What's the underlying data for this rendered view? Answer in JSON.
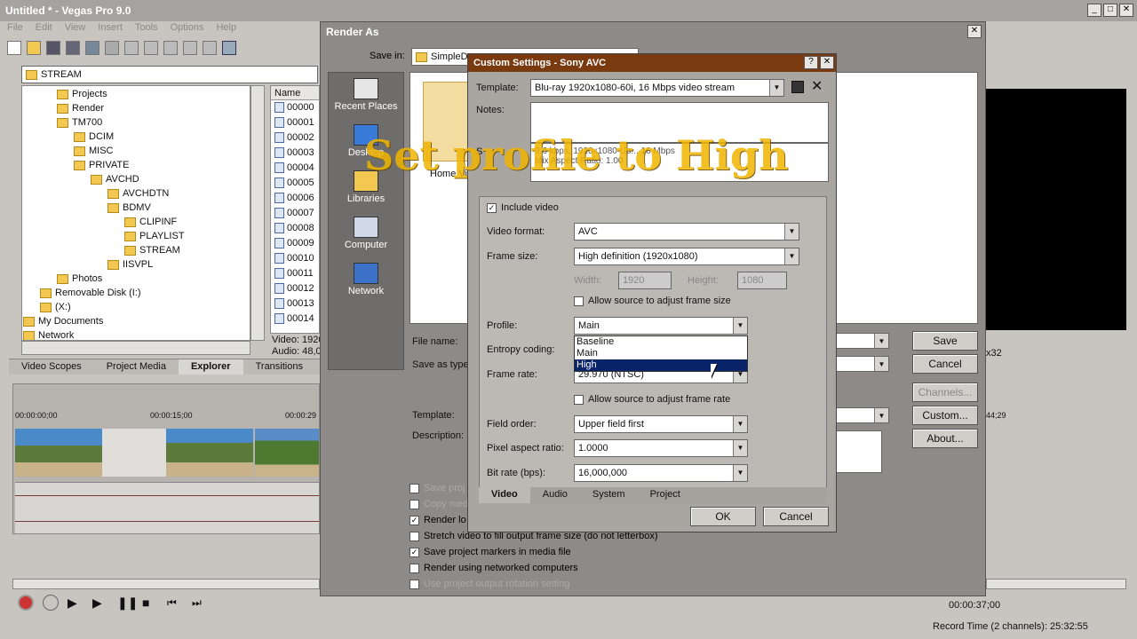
{
  "app": {
    "title": "Untitled * - Vegas Pro 9.0",
    "menu": [
      "File",
      "Edit",
      "View",
      "Insert",
      "Tools",
      "Options",
      "Help"
    ]
  },
  "explorer": {
    "path": "STREAM",
    "tree": [
      {
        "label": "Projects",
        "indent": 1
      },
      {
        "label": "Render",
        "indent": 1
      },
      {
        "label": "TM700",
        "indent": 1
      },
      {
        "label": "DCIM",
        "indent": 2
      },
      {
        "label": "MISC",
        "indent": 2
      },
      {
        "label": "PRIVATE",
        "indent": 2
      },
      {
        "label": "AVCHD",
        "indent": 3
      },
      {
        "label": "AVCHDTN",
        "indent": 4
      },
      {
        "label": "BDMV",
        "indent": 4
      },
      {
        "label": "CLIPINF",
        "indent": 5
      },
      {
        "label": "PLAYLIST",
        "indent": 5
      },
      {
        "label": "STREAM",
        "indent": 5
      },
      {
        "label": "IISVPL",
        "indent": 4
      },
      {
        "label": "Photos",
        "indent": 1
      },
      {
        "label": "Removable Disk (I:)",
        "indent": 0
      },
      {
        "label": "(X:)",
        "indent": 0
      },
      {
        "label": "My Documents",
        "indent": -1
      },
      {
        "label": "Network",
        "indent": -1
      }
    ],
    "files_header": "Name",
    "files": [
      "00000",
      "00001",
      "00002",
      "00003",
      "00004",
      "00005",
      "00006",
      "00007",
      "00008",
      "00009",
      "00010",
      "00011",
      "00012",
      "00013",
      "00014"
    ],
    "info1": "Video: 1920",
    "info2": "Audio: 48,0"
  },
  "tabs": [
    "Video Scopes",
    "Project Media",
    "Explorer",
    "Transitions"
  ],
  "timeline": {
    "t0": "00:00:00;00",
    "t1": "00:00:15;00",
    "t2": "00:00:29",
    "tr": "44;29",
    "end_time": "00:00:37;00",
    "status": "Record Time (2 channels): 25:32:55",
    "x32": "x32"
  },
  "render_as": {
    "title": "Render As",
    "save_in_label": "Save in:",
    "save_in_value": "SimpleD",
    "places": [
      "Recent Places",
      "Desktop",
      "Libraries",
      "Computer",
      "Network"
    ],
    "home_label": "Home Vi",
    "file_name_label": "File name:",
    "save_as_type_label": "Save as type",
    "template_label": "Template:",
    "description_label": "Description:",
    "buttons": {
      "save": "Save",
      "cancel": "Cancel",
      "channels": "Channels...",
      "custom": "Custom...",
      "about": "About..."
    },
    "options": [
      {
        "label": "Save proj",
        "checked": false,
        "disabled": true
      },
      {
        "label": "Copy med",
        "checked": false,
        "disabled": true
      },
      {
        "label": "Render lo",
        "checked": true,
        "disabled": false
      },
      {
        "label": "Stretch video to fill output frame size (do not letterbox)",
        "checked": false,
        "disabled": false
      },
      {
        "label": "Save project markers in media file",
        "checked": true,
        "disabled": false
      },
      {
        "label": "Render using networked computers",
        "checked": false,
        "disabled": false
      },
      {
        "label": "Use project output rotation setting",
        "checked": false,
        "disabled": true
      }
    ]
  },
  "custom": {
    "title": "Custom Settings - Sony AVC",
    "template_label": "Template:",
    "template_value": "Blu-ray 1920x1080-60i, 16 Mbps video stream",
    "notes_label": "Notes:",
    "summary_prefix": "S",
    "summary_line1": "9.6 kbps, 1920x1080 Up... 16 Mbps",
    "summary_line2": "Mix  Aspect Ratio: 1.00",
    "include_video": "Include video",
    "video_format_label": "Video format:",
    "video_format": "AVC",
    "frame_size_label": "Frame size:",
    "frame_size": "High definition (1920x1080)",
    "width_label": "Width:",
    "width": "1920",
    "height_label": "Height:",
    "height": "1080",
    "allow_frame_size": "Allow source to adjust frame size",
    "profile_label": "Profile:",
    "profile": "Main",
    "profile_options": [
      "Baseline",
      "Main",
      "High"
    ],
    "entropy_label": "Entropy coding:",
    "frame_rate_label": "Frame rate:",
    "frame_rate": "29.970 (NTSC)",
    "allow_frame_rate": "Allow source to adjust frame rate",
    "field_order_label": "Field order:",
    "field_order": "Upper field first",
    "pixel_aspect_label": "Pixel aspect ratio:",
    "pixel_aspect": "1.0000",
    "bit_rate_label": "Bit rate (bps):",
    "bit_rate": "16,000,000",
    "tabs": [
      "Video",
      "Audio",
      "System",
      "Project"
    ],
    "ok": "OK",
    "cancel": "Cancel"
  },
  "overlay": {
    "caption": "Set profile to High"
  },
  "colors": {
    "accent": "#0a246a",
    "caption": "#f0b400",
    "titlebar": "#9a9896"
  }
}
